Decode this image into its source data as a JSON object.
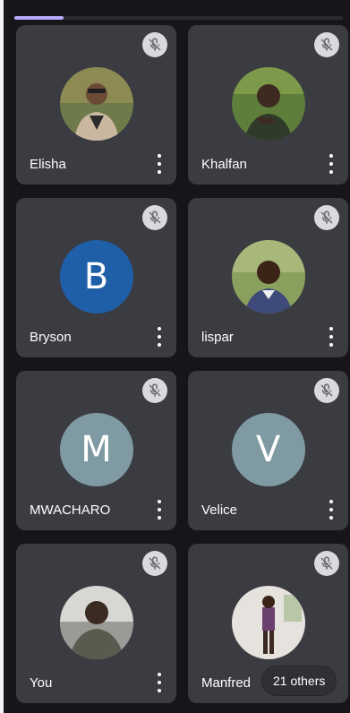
{
  "participants": [
    {
      "name": "Elisha",
      "avatar_type": "photo",
      "bg": "#6f7a4a",
      "mic": "mic-off-icon"
    },
    {
      "name": "Khalfan",
      "avatar_type": "photo",
      "bg": "#5f7d3b",
      "mic": "mic-off-icon"
    },
    {
      "name": "Bryson",
      "avatar_type": "initial",
      "initial": "B",
      "bg": "#1f5fa8",
      "mic": "mic-off-icon"
    },
    {
      "name": "lispar",
      "avatar_type": "photo",
      "bg": "#8aa05e",
      "mic": "mic-off-icon"
    },
    {
      "name": "MWACHARO",
      "avatar_type": "initial",
      "initial": "M",
      "bg": "#7f9aa2",
      "mic": "mic-off-icon"
    },
    {
      "name": "Velice",
      "avatar_type": "initial",
      "initial": "V",
      "bg": "#7f9aa2",
      "mic": "mic-off-icon"
    },
    {
      "name": "You",
      "avatar_type": "photo",
      "bg": "#d8d7d3",
      "mic": "mic-off-icon"
    },
    {
      "name": "Manfred",
      "avatar_type": "photo",
      "bg": "#e6e2dd",
      "mic": "mic-off-icon"
    }
  ],
  "others": {
    "label": "21 others"
  },
  "progress": {
    "fraction": 0.15,
    "color": "#b8a9ff"
  }
}
